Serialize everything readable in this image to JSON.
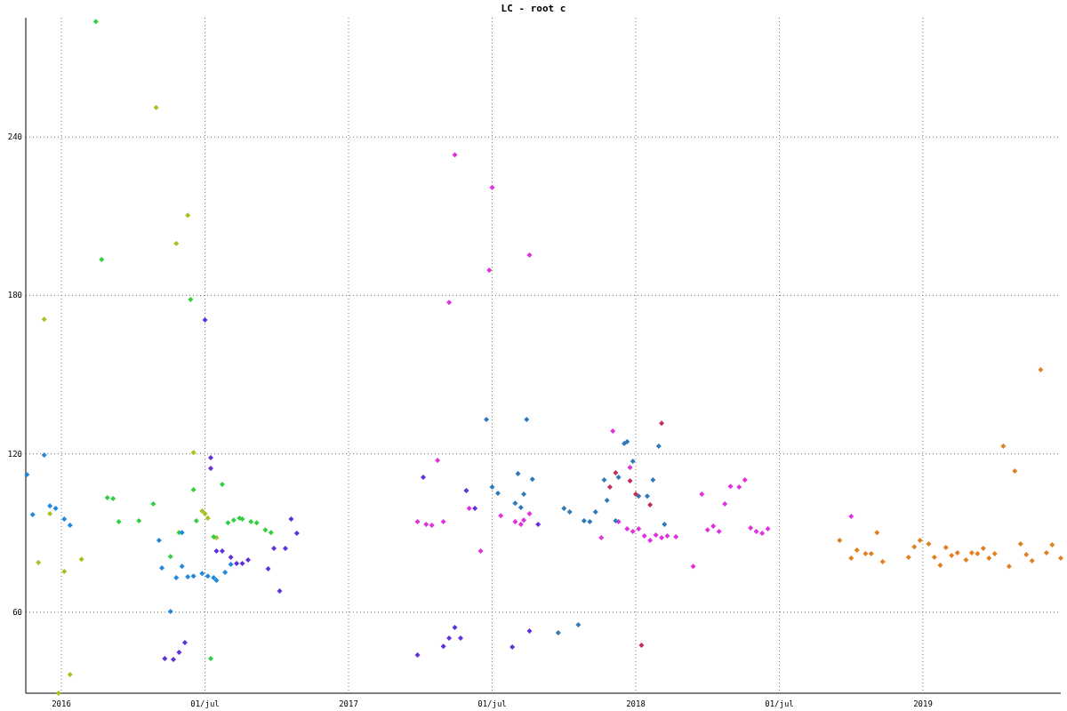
{
  "chart": {
    "chart_data": {
      "type": "scatter",
      "title": "LC - root c",
      "grid": true,
      "xlim": [
        2015.876,
        2019.48
      ],
      "ylim": [
        29.3,
        285.2
      ],
      "xticks": [
        {
          "value": 2016,
          "label": "2016"
        },
        {
          "value": 2016.5,
          "label": "01/jul"
        },
        {
          "value": 2017,
          "label": "2017"
        },
        {
          "value": 2017.5,
          "label": "01/jul"
        },
        {
          "value": 2018,
          "label": "2018"
        },
        {
          "value": 2018.5,
          "label": "01/jul"
        },
        {
          "value": 2019,
          "label": "2019"
        }
      ],
      "yticks": [
        60,
        120,
        180,
        240
      ],
      "series": [
        {
          "color": "#a8c020",
          "x": [
            2015.94,
            2015.92,
            2016.01,
            2015.96,
            2016.07,
            2016.03,
            2015.99,
            2016.33,
            2016.4,
            2016.44,
            2016.46,
            2016.5,
            2016.51,
            2016.49,
            2016.54
          ],
          "values": [
            171,
            78.8,
            75.4,
            97.3,
            80.1,
            36.4,
            29.3,
            251.2,
            199.7,
            210.4,
            120.5,
            97.3,
            95.6,
            98.3,
            88.2
          ]
        },
        {
          "color": "#30d040",
          "x": [
            2016.12,
            2016.14,
            2016.16,
            2016.18,
            2016.2,
            2016.27,
            2016.32,
            2016.38,
            2016.41,
            2016.45,
            2016.46,
            2016.47,
            2016.53,
            2016.56,
            2016.58,
            2016.6,
            2016.62,
            2016.63,
            2016.66,
            2016.68,
            2016.71,
            2016.73,
            2016.52
          ],
          "values": [
            283.8,
            193.6,
            103.4,
            103,
            94.3,
            94.6,
            101,
            81.1,
            90.2,
            178.5,
            106.4,
            94.6,
            88.6,
            108.4,
            93.9,
            94.9,
            95.6,
            95.3,
            94.3,
            93.9,
            91.2,
            90.2,
            42.4
          ]
        },
        {
          "color": "#2088e0",
          "x": [
            2015.88,
            2015.9,
            2015.94,
            2015.96,
            2015.98,
            2016.01,
            2016.03,
            2016.34,
            2016.35,
            2016.38,
            2016.4,
            2016.42,
            2016.42,
            2016.44,
            2016.46,
            2016.49,
            2016.51,
            2016.53,
            2016.54,
            2016.57,
            2016.59
          ],
          "values": [
            112.1,
            97,
            119.5,
            100.3,
            99.3,
            95.3,
            92.9,
            87.2,
            76.8,
            60.3,
            73.1,
            90.2,
            77.4,
            73.4,
            73.7,
            74.7,
            73.7,
            73.1,
            72.1,
            75.1,
            78.1
          ]
        },
        {
          "color": "#6030e0",
          "x": [
            2016.36,
            2016.39,
            2016.41,
            2016.43,
            2016.5,
            2016.52,
            2016.52,
            2016.54,
            2016.56,
            2016.59,
            2016.61,
            2016.63,
            2016.65,
            2016.72,
            2016.74,
            2016.76,
            2016.78,
            2016.8,
            2016.82,
            2017.24,
            2017.26,
            2017.33,
            2017.35,
            2017.37,
            2017.39,
            2017.41,
            2017.44,
            2017.57,
            2017.63,
            2017.66
          ],
          "values": [
            42.4,
            42.1,
            44.8,
            48.5,
            170.7,
            118.5,
            114.5,
            83.2,
            83.2,
            80.8,
            78.5,
            78.5,
            79.8,
            76.4,
            84.2,
            68,
            84.2,
            95.3,
            89.9,
            43.8,
            111.1,
            47.1,
            50.2,
            54.2,
            50.2,
            106.1,
            99.3,
            46.8,
            52.9,
            93.3
          ]
        },
        {
          "color": "#e030e0",
          "x": [
            2017.24,
            2017.27,
            2017.29,
            2017.31,
            2017.33,
            2017.35,
            2017.37,
            2017.42,
            2017.46,
            2017.49,
            2017.5,
            2017.53,
            2017.58,
            2017.6,
            2017.61,
            2017.63,
            2017.63,
            2017.88,
            2017.92,
            2017.94,
            2017.97,
            2017.99,
            2017.98,
            2018.01,
            2018.03,
            2018.05,
            2018.07,
            2018.09,
            2018.11,
            2018.14,
            2018.2,
            2018.23,
            2018.25,
            2018.27,
            2018.29,
            2018.31,
            2018.33,
            2018.36,
            2018.38,
            2018.4,
            2018.42,
            2018.44,
            2018.46,
            2018.75
          ],
          "values": [
            94.3,
            93.3,
            92.9,
            117.5,
            94.3,
            177.4,
            233.3,
            99.3,
            83.2,
            189.6,
            220.9,
            96.6,
            94.3,
            93.3,
            94.9,
            195.3,
            97.3,
            88.2,
            128.6,
            94.3,
            91.6,
            90.6,
            114.8,
            91.6,
            88.9,
            87.2,
            89.2,
            88.2,
            88.9,
            88.6,
            77.4,
            104.7,
            91.2,
            92.6,
            90.6,
            101,
            107.7,
            107.4,
            110.1,
            91.9,
            90.6,
            89.9,
            91.6,
            96.3
          ]
        },
        {
          "color": "#3078b8",
          "x": [
            2017.48,
            2017.5,
            2017.52,
            2017.58,
            2017.59,
            2017.6,
            2017.61,
            2017.62,
            2017.64,
            2017.75,
            2017.77,
            2017.82,
            2017.84,
            2017.86,
            2017.89,
            2017.9,
            2017.93,
            2017.94,
            2017.96,
            2017.97,
            2017.99,
            2018.01,
            2018.04,
            2018.06,
            2018.08,
            2018.1,
            2017.73,
            2017.8
          ],
          "values": [
            133,
            107.4,
            105.1,
            101.3,
            112.5,
            99.7,
            104.7,
            133,
            110.4,
            99.3,
            98,
            94.6,
            94.3,
            98,
            110.1,
            102.4,
            94.6,
            111.1,
            123.9,
            124.6,
            117.2,
            104,
            104,
            110.1,
            122.9,
            93.3,
            52.2,
            55.2
          ]
        },
        {
          "color": "#c03058",
          "x": [
            2017.91,
            2017.93,
            2017.98,
            2018.0,
            2018.02,
            2018.05,
            2018.09
          ],
          "values": [
            107.4,
            112.8,
            109.8,
            104.7,
            47.5,
            100.7,
            131.6
          ]
        },
        {
          "color": "#e08020",
          "x": [
            2018.71,
            2018.75,
            2018.77,
            2018.8,
            2018.82,
            2018.84,
            2018.86,
            2018.95,
            2018.97,
            2018.99,
            2019.02,
            2019.04,
            2019.06,
            2019.08,
            2019.1,
            2019.12,
            2019.15,
            2019.17,
            2019.19,
            2019.21,
            2019.23,
            2019.25,
            2019.28,
            2019.3,
            2019.32,
            2019.34,
            2019.36,
            2019.38,
            2019.41,
            2019.43,
            2019.45,
            2019.48
          ],
          "values": [
            87.2,
            80.5,
            83.5,
            82.2,
            82.2,
            90.2,
            79.1,
            80.8,
            84.8,
            87.2,
            85.9,
            80.8,
            77.8,
            84.5,
            81.5,
            82.5,
            79.8,
            82.5,
            82.2,
            84.2,
            80.5,
            82.2,
            122.9,
            77.4,
            113.5,
            85.9,
            81.8,
            79.5,
            151.9,
            82.5,
            85.5,
            80.5
          ]
        }
      ]
    }
  }
}
